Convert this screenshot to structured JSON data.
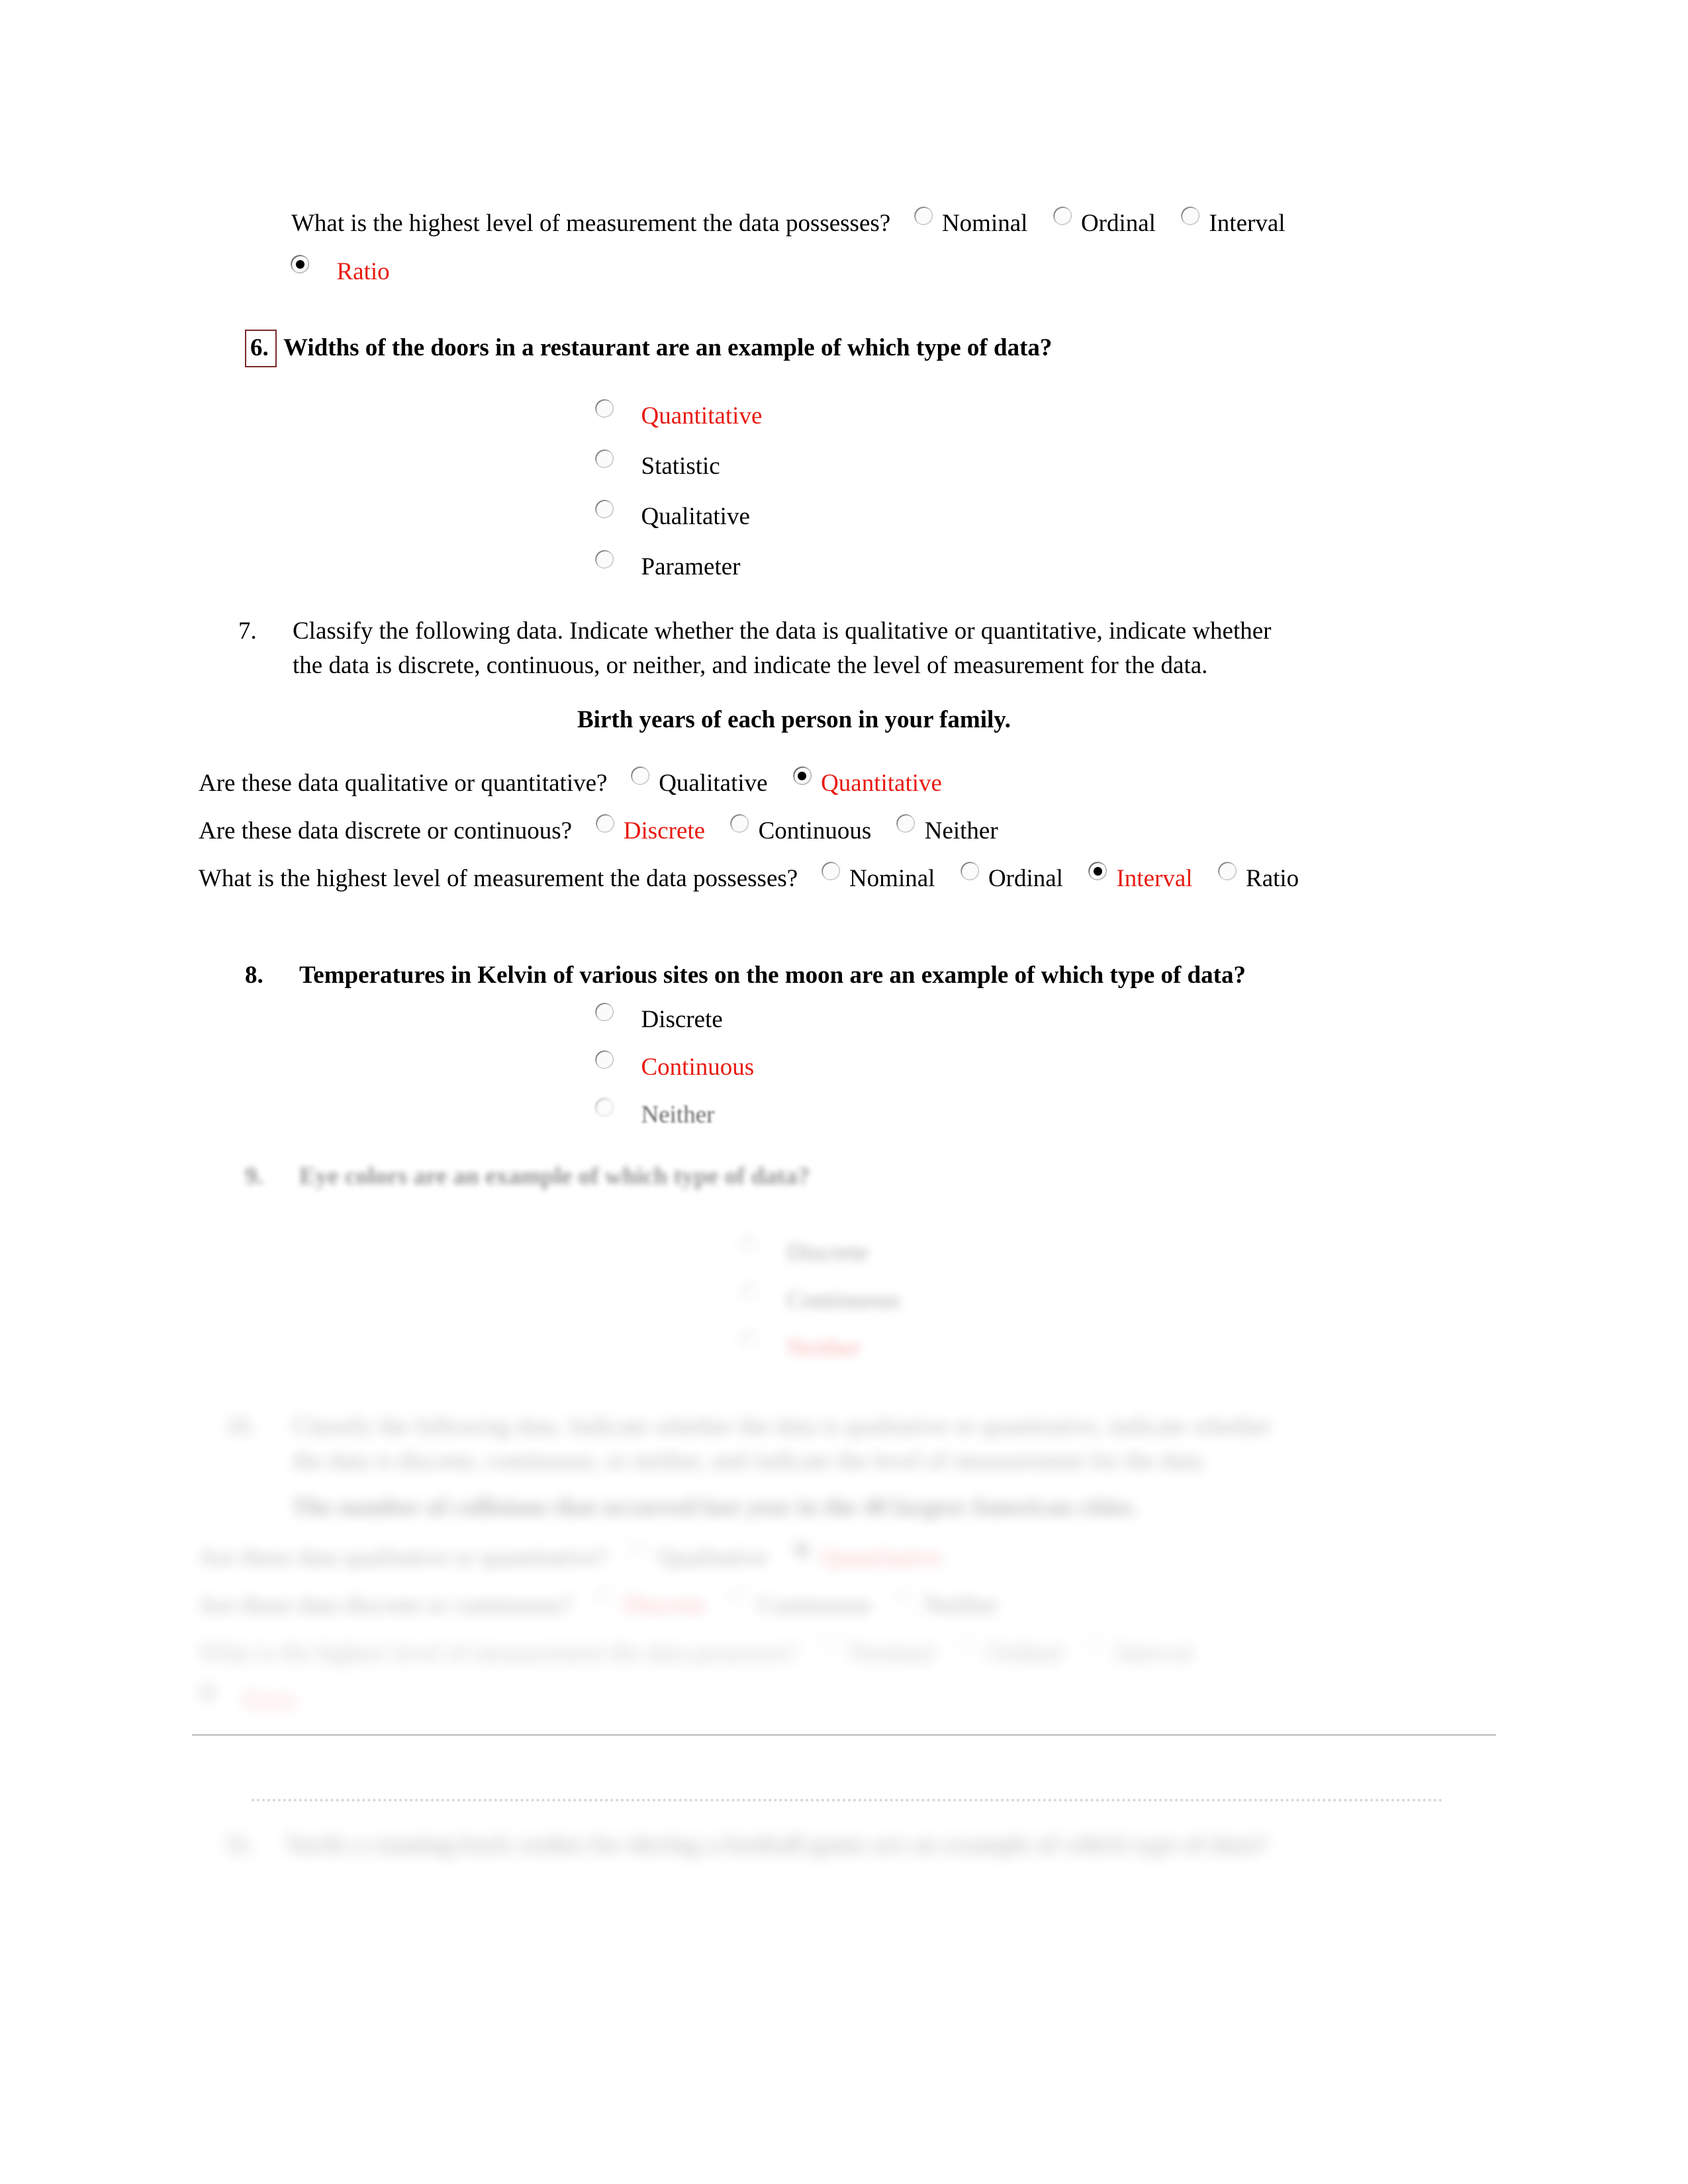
{
  "document": {
    "type": "statistics-worksheet",
    "answer_color": "#e8190f"
  },
  "q5_tail": {
    "prompt": "What is the highest level of measurement the data possesses?",
    "options": [
      "Nominal",
      "Ordinal",
      "Interval",
      "Ratio"
    ],
    "selected": "Ratio"
  },
  "q6": {
    "number": "6.",
    "prompt": "Widths of the doors in a restaurant are an example of which type of data?",
    "options": [
      "Quantitative",
      "Statistic",
      "Qualitative",
      "Parameter"
    ],
    "selected": "Quantitative"
  },
  "q7": {
    "number": "7.",
    "prompt_line1": "Classify the following data. Indicate whether the data is qualitative or quantitative, indicate whether",
    "prompt_line2": "the data is discrete, continuous, or neither, and indicate the level of measurement for the data.",
    "subject": "Birth years of each person in your family.",
    "rows": [
      {
        "label": "Are these data qualitative or quantitative?",
        "options": [
          "Qualitative",
          "Quantitative"
        ],
        "selected": "Quantitative"
      },
      {
        "label": "Are these data discrete or continuous?",
        "options": [
          "Discrete",
          "Continuous",
          "Neither"
        ],
        "selected": "Discrete"
      },
      {
        "label": "What is the highest level of measurement the data possesses?",
        "options": [
          "Nominal",
          "Ordinal",
          "Interval",
          "Ratio"
        ],
        "selected": "Interval"
      }
    ]
  },
  "q8": {
    "number": "8.",
    "prompt": "Temperatures in Kelvin of various sites on the moon are an example of which type of data?",
    "options": [
      "Discrete",
      "Continuous",
      "Neither"
    ],
    "selected": "Continuous"
  },
  "q9": {
    "number": "9.",
    "prompt": "Eye colors are an example of which type of data?",
    "options": [
      "Discrete",
      "Continuous",
      "Neither"
    ],
    "selected": "Neither"
  },
  "q10": {
    "number": "10.",
    "prompt_line1": "Classify the following data. Indicate whether the data is qualitative or quantitative, indicate whether",
    "prompt_line2": "the data is discrete, continuous, or neither, and indicate the level of measurement for the data.",
    "subject": "The number of collisions that occurred last year in the 40 largest American cities.",
    "rows": [
      {
        "label": "Are these data qualitative or quantitative?",
        "options": [
          "Qualitative",
          "Quantitative"
        ],
        "selected": "Quantitative"
      },
      {
        "label": "Are these data discrete or continuous?",
        "options": [
          "Discrete",
          "Continuous",
          "Neither"
        ],
        "selected": "Discrete"
      },
      {
        "label": "What is the highest level of measurement the data possesses?",
        "options": [
          "Nominal",
          "Ordinal",
          "Interval",
          "Ratio"
        ],
        "selected": "Ratio"
      }
    ]
  },
  "q11": {
    "number": "11.",
    "prompt": "Yards a running back rushes for during a football game are an example of which type of data?"
  }
}
